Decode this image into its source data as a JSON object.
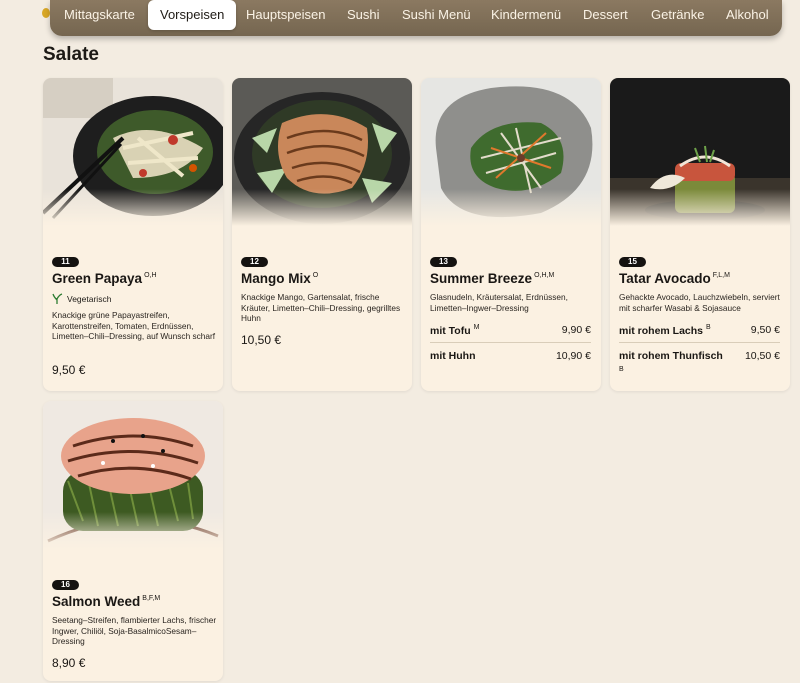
{
  "nav": {
    "tabs": [
      {
        "label": "Mittagskarte"
      },
      {
        "label": "Vorspeisen"
      },
      {
        "label": "Hauptspeisen"
      },
      {
        "label": "Sushi"
      },
      {
        "label": "Sushi Menü"
      },
      {
        "label": "Kindermenü"
      },
      {
        "label": "Dessert"
      },
      {
        "label": "Getränke"
      },
      {
        "label": "Alkohol"
      }
    ],
    "active_tab": "Vorspeisen"
  },
  "section": {
    "title": "Salate"
  },
  "dishes": [
    {
      "number": "11",
      "name": "Green Papaya",
      "allergens": "O,H",
      "tag": "Vegetarisch",
      "tag_icon": "leaf-icon",
      "description": "Knackige grüne Papayastreifen, Karottenstreifen, Tomaten, Erdnüssen, Limetten–Chili–Dressing, auf Wunsch scharf",
      "price": "9,50 €"
    },
    {
      "number": "12",
      "name": "Mango Mix",
      "allergens": "O",
      "description": "Knackige Mango, Gartensalat, frische Kräuter, Limetten–Chili–Dressing, gegrilltes Huhn",
      "price": "10,50 €"
    },
    {
      "number": "13",
      "name": "Summer Breeze",
      "allergens": "O,H,M",
      "description": "Glasnudeln, Kräutersalat, Erdnüssen, Limetten–Ingwer–Dressing",
      "variants": [
        {
          "label": "mit Tofu",
          "allergens": "M",
          "price": "9,90 €"
        },
        {
          "label": "mit Huhn",
          "allergens": "",
          "price": "10,90 €"
        }
      ]
    },
    {
      "number": "15",
      "name": "Tatar Avocado",
      "allergens": "F,L,M",
      "description": "Gehackte Avocado, Lauchzwiebeln, serviert mit scharfer Wasabi & Sojasauce",
      "variants": [
        {
          "label": "mit rohem Lachs",
          "allergens": "B",
          "price": "9,50 €"
        },
        {
          "label": "mit rohem Thunfisch",
          "allergens": "B",
          "price": "10,50 €"
        }
      ]
    },
    {
      "number": "16",
      "name": "Salmon Weed",
      "allergens": "B,F,M",
      "description": "Seetang–Streifen, flambierter Lachs, frischer Ingwer, Chiliöl, Soja-BasalmicoSesam–Dressing",
      "price": "8,90 €"
    }
  ],
  "colors": {
    "page_bg": "#f3ece1",
    "card_bg": "#fbf1e2",
    "nav_bg": "#7f6e57",
    "badge_bg": "#141210",
    "veg_green": "#2e7d32"
  }
}
